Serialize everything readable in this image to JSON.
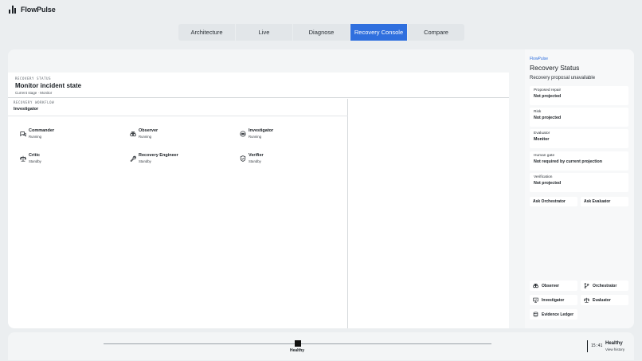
{
  "app": {
    "name": "FlowPulse",
    "logo_icon": "bar-chart-icon"
  },
  "tabs": [
    {
      "label": "Architecture",
      "active": false
    },
    {
      "label": "Live",
      "active": false
    },
    {
      "label": "Diagnose",
      "active": false
    },
    {
      "label": "Recovery Console",
      "active": true
    },
    {
      "label": "Compare",
      "active": false
    }
  ],
  "colors": {
    "accent": "#2f6fde",
    "background": "#ebeef0"
  },
  "stage": {
    "caption": "RECOVERY STATUS",
    "title": "Monitor incident state",
    "subtitle": "Current stage · Monitor"
  },
  "workflow": {
    "caption": "RECOVERY WORKFLOW",
    "title": "Investigator",
    "agents": [
      {
        "name": "Commander",
        "status": "Running",
        "icon": "chat-icon"
      },
      {
        "name": "Observer",
        "status": "Running",
        "icon": "binoculars-icon"
      },
      {
        "name": "Investigator",
        "status": "Running",
        "icon": "eye-icon"
      },
      {
        "name": "Critic",
        "status": "Standby",
        "icon": "scale-icon"
      },
      {
        "name": "Recovery Engineer",
        "status": "Standby",
        "icon": "wrench-icon"
      },
      {
        "name": "Verifier",
        "status": "Standby",
        "icon": "shield-icon"
      }
    ]
  },
  "panel": {
    "brand": "FlowPulse",
    "title": "Recovery Status",
    "subtitle": "Recovery proposal unavailable",
    "fields": [
      {
        "key": "Proposed repair",
        "value": "Not projected"
      },
      {
        "key": "Risk",
        "value": "Not projected"
      },
      {
        "key": "Evaluator",
        "value": "Monitor"
      },
      {
        "key": "Human gate",
        "value": "Not required by current projection"
      },
      {
        "key": "Verification",
        "value": "Not projected"
      }
    ],
    "ask_orchestrator": "Ask Orchestrator",
    "ask_evaluator": "Ask Evaluator",
    "nav": [
      {
        "label": "Observer",
        "icon": "binoculars-icon"
      },
      {
        "label": "Orchestrator",
        "icon": "branch-icon"
      },
      {
        "label": "Investigator",
        "icon": "monitor-icon"
      },
      {
        "label": "Evaluator",
        "icon": "scale-icon"
      },
      {
        "label": "Evidence Ledger",
        "icon": "database-icon"
      }
    ]
  },
  "timeline": {
    "marker_label": "Healthy",
    "time": "15:41",
    "status": "Healthy",
    "history_link": "View history"
  }
}
